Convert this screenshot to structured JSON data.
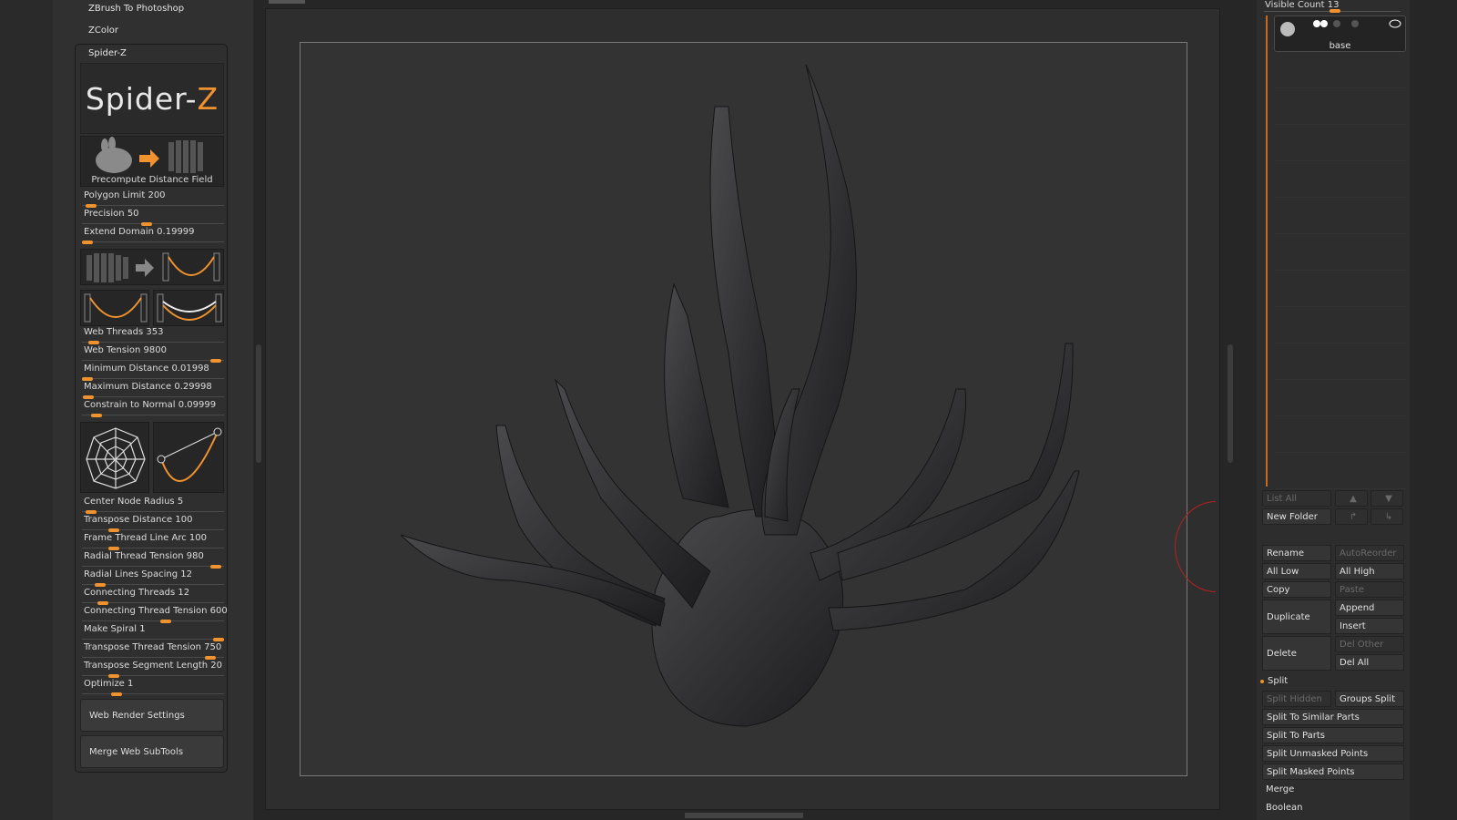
{
  "menu": {
    "zbrush_to_photoshop": "ZBrush To Photoshop",
    "zcolor": "ZColor"
  },
  "spiderz": {
    "title": "Spider-Z",
    "logo_main": "Spider-",
    "logo_accent": "Z",
    "precompute_label": "Precompute Distance Field",
    "sliders_a": [
      {
        "label": "Polygon Limit",
        "value": "200",
        "fraction": 0.03
      },
      {
        "label": "Precision",
        "value": "50",
        "fraction": 0.45
      },
      {
        "label": "Extend Domain",
        "value": "0.19999",
        "fraction": 0.0
      }
    ],
    "sliders_b": [
      {
        "label": "Web Threads",
        "value": "353",
        "fraction": 0.05
      },
      {
        "label": "Web Tension",
        "value": "9800",
        "fraction": 0.98
      },
      {
        "label": "Minimum Distance",
        "value": "0.01998",
        "fraction": 0.0
      },
      {
        "label": "Maximum Distance",
        "value": "0.29998",
        "fraction": 0.01
      },
      {
        "label": "Constrain to Normal",
        "value": "0.09999",
        "fraction": 0.07
      }
    ],
    "sliders_c": [
      {
        "label": "Center Node Radius",
        "value": "5",
        "fraction": 0.03
      },
      {
        "label": "Transpose Distance",
        "value": "100",
        "fraction": 0.2
      },
      {
        "label": "Frame Thread Line Arc",
        "value": "100",
        "fraction": 0.2
      },
      {
        "label": "Radial Thread Tension",
        "value": "980",
        "fraction": 0.98
      },
      {
        "label": "Radial Lines Spacing",
        "value": "12",
        "fraction": 0.1
      },
      {
        "label": "Connecting Threads",
        "value": "12",
        "fraction": 0.12
      },
      {
        "label": "Connecting Thread Tension",
        "value": "600",
        "fraction": 0.6
      },
      {
        "label": "Make Spiral",
        "value": "1",
        "fraction": 1.0
      },
      {
        "label": "Transpose Thread Tension",
        "value": "750",
        "fraction": 0.94
      },
      {
        "label": "Transpose Segment Length",
        "value": "20",
        "fraction": 0.2
      },
      {
        "label": "Optimize",
        "value": "1",
        "fraction": 0.22
      }
    ],
    "web_render_settings": "Web Render Settings",
    "merge_web_subtools": "Merge Web SubTools"
  },
  "subtool": {
    "visible_count_label": "Visible Count",
    "visible_count_value": "13",
    "visible_count_fraction": 0.5,
    "item_name": "base",
    "list_all": "List All",
    "new_folder": "New Folder",
    "rename": "Rename",
    "autoreorder": "AutoReorder",
    "all_low": "All Low",
    "all_high": "All High",
    "copy": "Copy",
    "paste": "Paste",
    "duplicate": "Duplicate",
    "append": "Append",
    "insert": "Insert",
    "delete": "Delete",
    "del_other": "Del Other",
    "del_all": "Del All",
    "split": "Split",
    "split_hidden": "Split Hidden",
    "groups_split": "Groups Split",
    "split_similar": "Split To Similar Parts",
    "split_parts": "Split To Parts",
    "split_unmasked": "Split Unmasked Points",
    "split_masked": "Split Masked Points",
    "merge": "Merge",
    "boolean": "Boolean"
  },
  "colors": {
    "accent": "#f0922e",
    "panel": "#303030",
    "canvas": "#333333"
  }
}
